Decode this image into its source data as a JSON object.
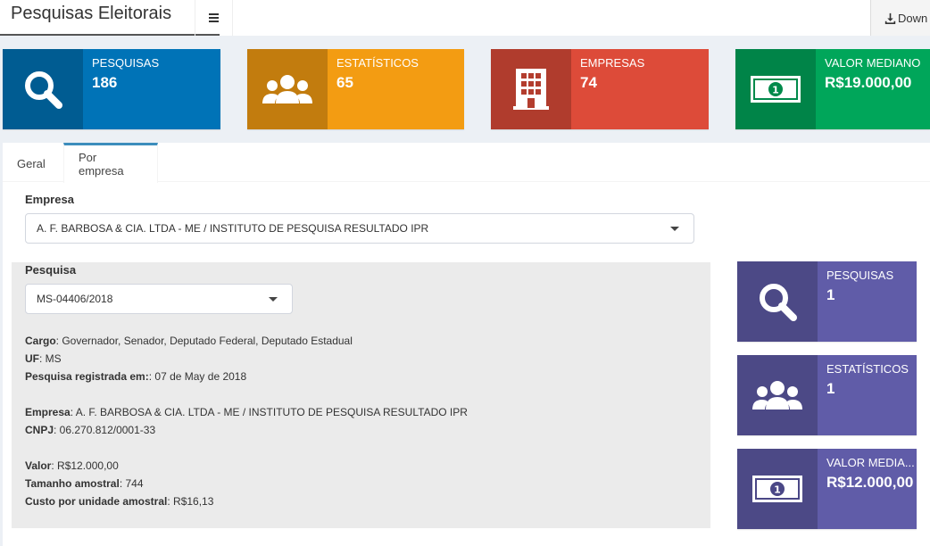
{
  "header": {
    "brand": "Pesquisas Eleitorais",
    "download_label": "Down"
  },
  "stats": [
    {
      "label": "PESQUISAS",
      "value": "186",
      "icon": "search-icon",
      "color": "#0073b7"
    },
    {
      "label": "ESTATÍSTICOS",
      "value": "65",
      "icon": "users-icon",
      "color": "#f39c12"
    },
    {
      "label": "EMPRESAS",
      "value": "74",
      "icon": "building-icon",
      "color": "#dd4b39"
    },
    {
      "label": "VALOR MEDIANO",
      "value": "R$19.000,00",
      "icon": "money-icon",
      "color": "#00a65a"
    }
  ],
  "tabs": [
    {
      "label": "Geral"
    },
    {
      "label": "Por empresa"
    }
  ],
  "empresa": {
    "label": "Empresa",
    "selected": "A. F. BARBOSA & CIA. LTDA - ME / INSTITUTO DE PESQUISA RESULTADO IPR"
  },
  "pesquisa": {
    "label": "Pesquisa",
    "selected": "MS-04406/2018"
  },
  "details": {
    "cargo_label": "Cargo",
    "cargo": ": Governador, Senador, Deputado Federal, Deputado Estadual",
    "uf_label": "UF",
    "uf": ": MS",
    "registrada_label": "Pesquisa registrada em:",
    "registrada": ": 07 de May de 2018",
    "empresa_label": "Empresa",
    "empresa": ": A. F. BARBOSA & CIA. LTDA - ME / INSTITUTO DE PESQUISA RESULTADO IPR",
    "cnpj_label": "CNPJ",
    "cnpj": ": 06.270.812/0001-33",
    "valor_label": "Valor",
    "valor": ": R$12.000,00",
    "tamanho_label": "Tamanho amostral",
    "tamanho": ": 744",
    "custo_label": "Custo por unidade amostral",
    "custo": ": R$16,13"
  },
  "side_stats": [
    {
      "label": "PESQUISAS",
      "value": "1",
      "icon": "search-icon",
      "color": "#605ca8"
    },
    {
      "label": "ESTATÍSTICOS",
      "value": "1",
      "icon": "users-icon",
      "color": "#605ca8"
    },
    {
      "label": "VALOR MEDIA...",
      "value": "R$12.000,00",
      "icon": "money-icon",
      "color": "#605ca8"
    }
  ]
}
